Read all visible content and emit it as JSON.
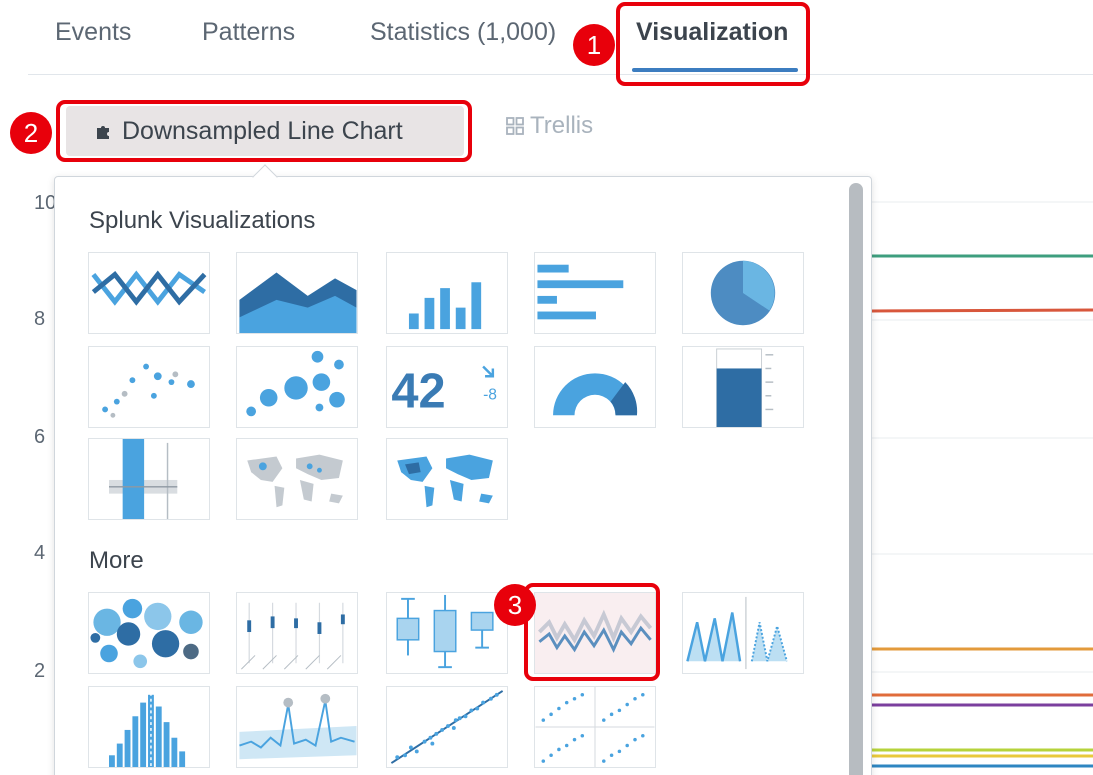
{
  "tabs": {
    "events": "Events",
    "patterns": "Patterns",
    "statistics": "Statistics (1,000)",
    "visualization": "Visualization"
  },
  "toolbar": {
    "viz_type_label": "Downsampled Line Chart",
    "trellis_label": "Trellis"
  },
  "callouts": [
    "1",
    "2",
    "3"
  ],
  "chart_y_ticks": [
    "10",
    "8",
    "6",
    "4",
    "2"
  ],
  "picker": {
    "splunk_title": "Splunk Visualizations",
    "more_title": "More",
    "splunk_tiles": [
      "line-chart-icon",
      "area-chart-icon",
      "column-chart-icon",
      "bar-chart-icon",
      "pie-chart-icon",
      "scatter-chart-icon",
      "bubble-chart-icon",
      "single-value-icon",
      "radial-gauge-icon",
      "filler-gauge-icon",
      "marker-gauge-icon",
      "cluster-map-icon",
      "choropleth-map-icon"
    ],
    "single_value": {
      "value": "42",
      "delta": "-8"
    },
    "more_tiles": [
      "packed-bubble-icon",
      "parallel-coordinates-icon",
      "box-plot-icon",
      "downsampled-line-chart-icon",
      "horizon-chart-icon",
      "histogram-icon",
      "outlier-chart-icon",
      "scatter-line-icon",
      "scatterplot-matrix-icon"
    ],
    "selected": "downsampled-line-chart-icon"
  },
  "colors": {
    "accent_blue": "#3c7dc0",
    "callout_red": "#e8000b",
    "tile_blue": "#4aa3df",
    "tile_dark": "#2e6da4"
  }
}
